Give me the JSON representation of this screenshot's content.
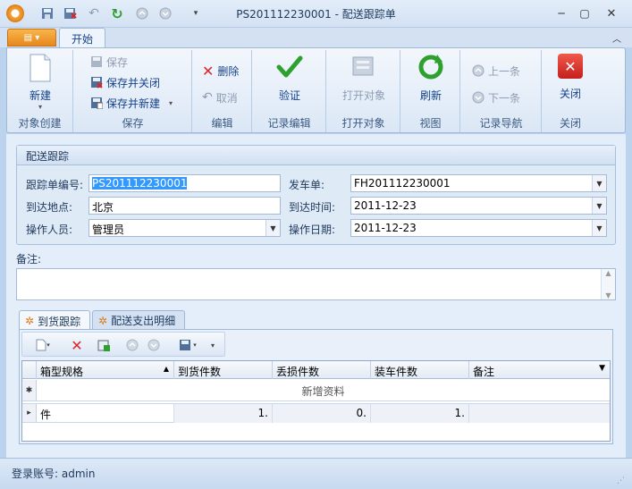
{
  "window": {
    "title": "PS201112230001 - 配送跟踪单"
  },
  "tabs": {
    "start": "开始"
  },
  "ribbon": {
    "new": "新建",
    "save": "保存",
    "save_close": "保存并关闭",
    "save_new": "保存并新建",
    "delete": "删除",
    "cancel": "取消",
    "validate": "验证",
    "open_object": "打开对象",
    "refresh": "刷新",
    "prev": "上一条",
    "next": "下一条",
    "close": "关闭",
    "groups": {
      "create": "对象创建",
      "save": "保存",
      "edit": "编辑",
      "record_edit": "记录编辑",
      "open_object": "打开对象",
      "view": "视图",
      "nav": "记录导航",
      "close": "关闭"
    }
  },
  "form": {
    "panel_title": "配送跟踪",
    "tracking_no_label": "跟踪单编号:",
    "tracking_no": "PS201112230001",
    "dispatch_label": "发车单:",
    "dispatch": "FH201112230001",
    "arrive_place_label": "到达地点:",
    "arrive_place": "北京",
    "arrive_time_label": "到达时间:",
    "arrive_time": "2011-12-23",
    "operator_label": "操作人员:",
    "operator": "管理员",
    "op_date_label": "操作日期:",
    "op_date": "2011-12-23",
    "notes_label": "备注:"
  },
  "detail_tabs": {
    "tab1": "到货跟踪",
    "tab2": "配送支出明细"
  },
  "grid": {
    "columns": [
      "箱型规格",
      "到货件数",
      "丢损件数",
      "装车件数",
      "备注"
    ],
    "new_row": "新增资料",
    "rows": [
      {
        "spec": "件",
        "arrived": "1.",
        "lost": "0.",
        "loaded": "1.",
        "note": ""
      }
    ]
  },
  "status": {
    "login": "登录账号: admin"
  },
  "colors": {
    "accent": "#15428b",
    "selection": "#3399ff",
    "delete_red": "#d9262a",
    "ok_green": "#2ea02e"
  }
}
